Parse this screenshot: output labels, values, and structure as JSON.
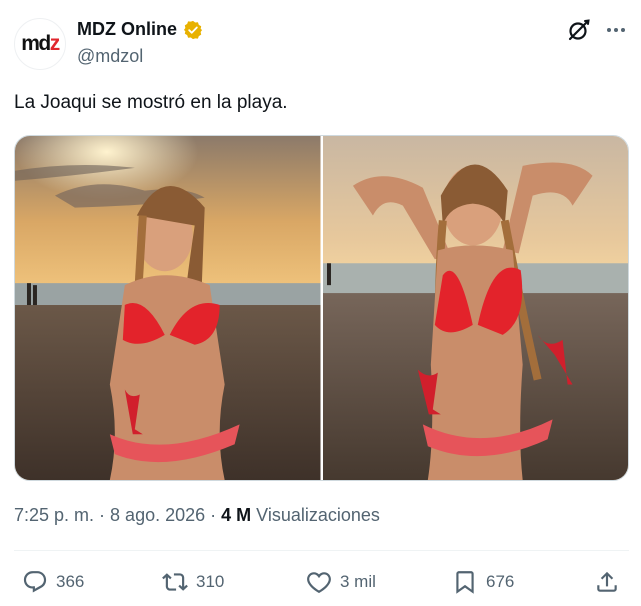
{
  "account": {
    "display_name": "MDZ Online",
    "handle": "@mdzol",
    "avatar_text_main": "md",
    "avatar_text_accent": "z",
    "verified_color": "#e8b100"
  },
  "post": {
    "text": "La Joaqui se mostró en la playa.",
    "media_count": 2
  },
  "meta": {
    "time": "7:25 p. m.",
    "separator": "·",
    "date": "8 ago. 2026",
    "views_count": "4 M",
    "views_label": "Visualizaciones"
  },
  "actions": {
    "replies": "366",
    "reposts": "310",
    "likes": "3 mil",
    "bookmarks": "676"
  },
  "icons": [
    "verified-badge-icon",
    "grok-icon",
    "more-icon",
    "reply-icon",
    "repost-icon",
    "like-icon",
    "bookmark-icon",
    "share-icon"
  ],
  "colors": {
    "text": "#0f1419",
    "secondary": "#536471",
    "border": "#cfd9de"
  }
}
